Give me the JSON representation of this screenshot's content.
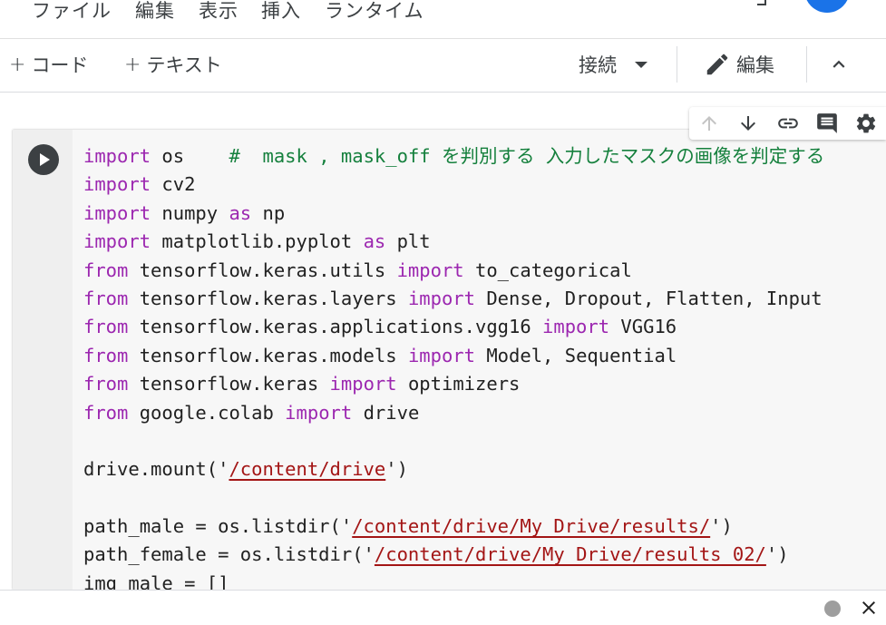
{
  "menu": {
    "items": [
      "ファイル",
      "編集",
      "表示",
      "挿入",
      "ランタイム"
    ]
  },
  "toolbar": {
    "add_code_label": "コード",
    "add_text_label": "テキスト",
    "connect_label": "接続",
    "edit_label": "編集"
  },
  "cell_toolbar": {
    "icons": [
      "arrow-up-icon",
      "arrow-down-icon",
      "link-icon",
      "comment-icon",
      "gear-icon"
    ]
  },
  "code": {
    "lines": [
      [
        {
          "t": "kw",
          "v": "import"
        },
        {
          "t": "p",
          "v": " os    "
        },
        {
          "t": "cm",
          "v": "#  mask , mask_off を判別する 入力したマスクの画像を判定する"
        }
      ],
      [
        {
          "t": "kw",
          "v": "import"
        },
        {
          "t": "p",
          "v": " cv2"
        }
      ],
      [
        {
          "t": "kw",
          "v": "import"
        },
        {
          "t": "p",
          "v": " numpy "
        },
        {
          "t": "kw",
          "v": "as"
        },
        {
          "t": "p",
          "v": " np"
        }
      ],
      [
        {
          "t": "kw",
          "v": "import"
        },
        {
          "t": "p",
          "v": " matplotlib.pyplot "
        },
        {
          "t": "kw",
          "v": "as"
        },
        {
          "t": "p",
          "v": " plt"
        }
      ],
      [
        {
          "t": "kw",
          "v": "from"
        },
        {
          "t": "p",
          "v": " tensorflow.keras.utils "
        },
        {
          "t": "kw",
          "v": "import"
        },
        {
          "t": "p",
          "v": " to_categorical"
        }
      ],
      [
        {
          "t": "kw",
          "v": "from"
        },
        {
          "t": "p",
          "v": " tensorflow.keras.layers "
        },
        {
          "t": "kw",
          "v": "import"
        },
        {
          "t": "p",
          "v": " Dense, Dropout, Flatten, Input"
        }
      ],
      [
        {
          "t": "kw",
          "v": "from"
        },
        {
          "t": "p",
          "v": " tensorflow.keras.applications.vgg16 "
        },
        {
          "t": "kw",
          "v": "import"
        },
        {
          "t": "p",
          "v": " VGG16"
        }
      ],
      [
        {
          "t": "kw",
          "v": "from"
        },
        {
          "t": "p",
          "v": " tensorflow.keras.models "
        },
        {
          "t": "kw",
          "v": "import"
        },
        {
          "t": "p",
          "v": " Model, Sequential"
        }
      ],
      [
        {
          "t": "kw",
          "v": "from"
        },
        {
          "t": "p",
          "v": " tensorflow.keras "
        },
        {
          "t": "kw",
          "v": "import"
        },
        {
          "t": "p",
          "v": " optimizers"
        }
      ],
      [
        {
          "t": "kw",
          "v": "from"
        },
        {
          "t": "p",
          "v": " google.colab "
        },
        {
          "t": "kw",
          "v": "import"
        },
        {
          "t": "p",
          "v": " drive"
        }
      ],
      [],
      [
        {
          "t": "p",
          "v": "drive.mount('"
        },
        {
          "t": "str",
          "v": "/content/drive"
        },
        {
          "t": "p",
          "v": "')"
        }
      ],
      [],
      [
        {
          "t": "p",
          "v": "path_male = os.listdir('"
        },
        {
          "t": "str",
          "v": "/content/drive/My Drive/results/"
        },
        {
          "t": "p",
          "v": "')"
        }
      ],
      [
        {
          "t": "p",
          "v": "path_female = os.listdir('"
        },
        {
          "t": "str",
          "v": "/content/drive/My Drive/results_02/"
        },
        {
          "t": "p",
          "v": "')"
        }
      ],
      [
        {
          "t": "p",
          "v": "img_male = []"
        }
      ]
    ]
  },
  "colors": {
    "keyword": "#9c27b0",
    "comment": "#15803d",
    "string": "#a31515",
    "accent": "#1a73e8"
  }
}
